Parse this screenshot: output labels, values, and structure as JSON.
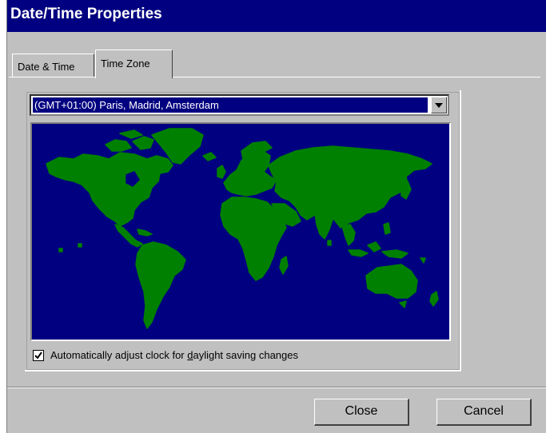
{
  "window": {
    "title": "Date/Time Properties"
  },
  "tabs": [
    {
      "label": "Date & Time",
      "active": false
    },
    {
      "label": "Time Zone",
      "active": true
    }
  ],
  "timezone": {
    "selected": "(GMT+01:00) Paris, Madrid, Amsterdam"
  },
  "map": {
    "ocean_color": "#000080",
    "land_color": "#008000"
  },
  "daylight": {
    "checked": true,
    "label_before": "Automatically adjust clock for ",
    "label_accel": "d",
    "label_after": "aylight saving changes"
  },
  "buttons": {
    "close": "Close",
    "cancel": "Cancel"
  }
}
